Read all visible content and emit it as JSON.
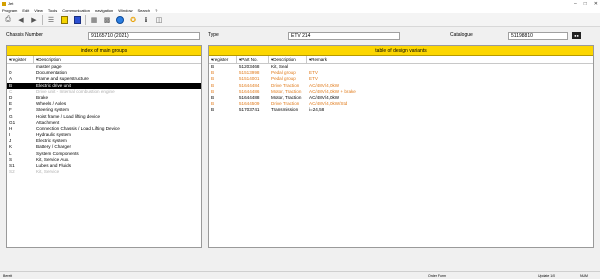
{
  "window": {
    "title": "Jet"
  },
  "menu": [
    "Program",
    "Edit",
    "View",
    "Tools",
    "Communication",
    "navigation",
    "Window",
    "Search",
    "?"
  ],
  "toolbar_icons": [
    "print-icon",
    "back-icon",
    "forward-icon",
    "list-icon",
    "yellow-note-icon",
    "blue-book-icon",
    "grid-icon",
    "tile-icon",
    "globe-icon",
    "star-icon",
    "info-icon",
    "document-icon"
  ],
  "info": {
    "chassis_label": "Chassis Number",
    "chassis_value": "91165710  (2021)",
    "type_label": "Type",
    "type_value": "ETV 214",
    "catalogue_label": "Catalogue",
    "catalogue_value": "51198810"
  },
  "left_panel": {
    "title": "index of main groups",
    "col_register": "register",
    "col_description": "Description",
    "rows": [
      {
        "reg": "",
        "desc": "master page",
        "state": "normal"
      },
      {
        "reg": "0",
        "desc": "Documentation",
        "state": "normal"
      },
      {
        "reg": "A",
        "desc": "Frame and superstructure",
        "state": "normal"
      },
      {
        "reg": "B",
        "desc": "Electric drive unit",
        "state": "selected"
      },
      {
        "reg": "C",
        "desc": "Drive unit - Internal combustion engine",
        "state": "dim"
      },
      {
        "reg": "D",
        "desc": "Brake",
        "state": "normal"
      },
      {
        "reg": "E",
        "desc": "Wheels / Axles",
        "state": "normal"
      },
      {
        "reg": "F",
        "desc": "Steering system",
        "state": "normal"
      },
      {
        "reg": "G",
        "desc": "Hoist frame / Load lifting device",
        "state": "normal"
      },
      {
        "reg": "G1",
        "desc": "Attachment",
        "state": "normal"
      },
      {
        "reg": "H",
        "desc": "Connection Chassis / Load Lifting Device",
        "state": "normal"
      },
      {
        "reg": "I",
        "desc": "Hydraulic system",
        "state": "normal"
      },
      {
        "reg": "J",
        "desc": "Electric system",
        "state": "normal"
      },
      {
        "reg": "K",
        "desc": "Battery / Charger",
        "state": "normal"
      },
      {
        "reg": "L",
        "desc": "System Components",
        "state": "normal"
      },
      {
        "reg": "S",
        "desc": "Kit, Service Aux.",
        "state": "normal"
      },
      {
        "reg": "S1",
        "desc": "Lubes and Fluids",
        "state": "normal"
      },
      {
        "reg": "S2",
        "desc": "Kit, Service",
        "state": "dim"
      }
    ]
  },
  "right_panel": {
    "title": "table of design variants",
    "col_register": "register",
    "col_partno": "Part No.",
    "col_description": "Description",
    "col_remark": "Remark",
    "rows": [
      {
        "reg": "B",
        "part": "51203468",
        "desc": "Kit, Seal",
        "remark": "",
        "state": "normal"
      },
      {
        "reg": "B",
        "part": "51513998",
        "desc": "Pedal group",
        "remark": "ETV",
        "state": "orange"
      },
      {
        "reg": "B",
        "part": "51514001",
        "desc": "Pedal group",
        "remark": "ETV",
        "state": "orange"
      },
      {
        "reg": "B",
        "part": "51644484",
        "desc": "Drive Traction",
        "remark": "AC/48V/4,0kW",
        "state": "orange"
      },
      {
        "reg": "B",
        "part": "51644486",
        "desc": "Motor, Traction",
        "remark": "AC/48V/4,0kW + brake",
        "state": "orange"
      },
      {
        "reg": "B",
        "part": "51644488",
        "desc": "Motor, Traction",
        "remark": "AC/48V/4,0kW",
        "state": "normal"
      },
      {
        "reg": "B",
        "part": "51644509",
        "desc": "Drive Traction",
        "remark": "AC/48V/4,0kW/Std",
        "state": "orange"
      },
      {
        "reg": "B",
        "part": "51703741",
        "desc": "Transmission",
        "remark": "i=24,58",
        "state": "normal"
      }
    ]
  },
  "status": {
    "left": "Bereit",
    "mid": "Order Form",
    "right1": "Update 1/0",
    "right2": "NUM"
  },
  "colors": {
    "header_yellow": "#fcd600",
    "selection": "#000000",
    "orange_text": "#e07a1a",
    "dim_text": "#b0b0b0"
  }
}
